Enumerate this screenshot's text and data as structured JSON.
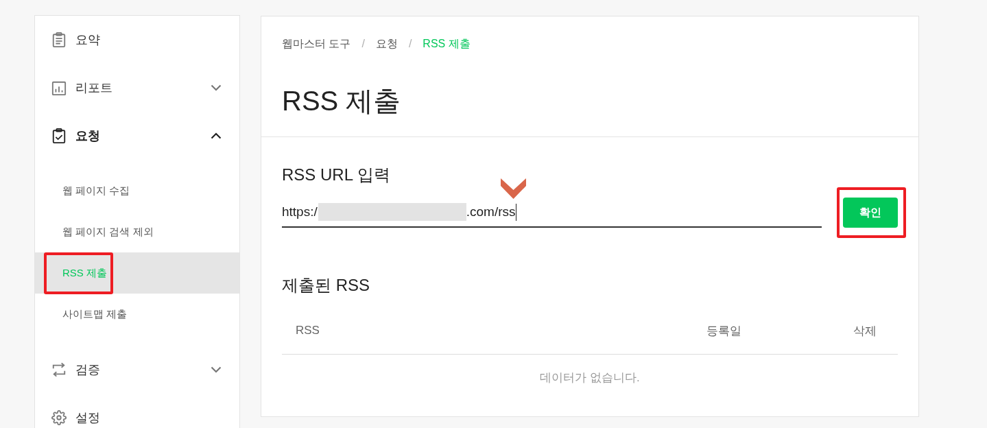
{
  "sidebar": {
    "items": [
      {
        "label": "요약",
        "kind": "link"
      },
      {
        "label": "리포트",
        "kind": "group",
        "expanded": false
      },
      {
        "label": "요청",
        "kind": "group",
        "expanded": true,
        "children": [
          {
            "label": "웹 페이지 수집",
            "selected": false,
            "highlighted": false
          },
          {
            "label": "웹 페이지 검색 제외",
            "selected": false,
            "highlighted": false
          },
          {
            "label": "RSS 제출",
            "selected": true,
            "highlighted": true
          },
          {
            "label": "사이트맵 제출",
            "selected": false,
            "highlighted": false
          }
        ]
      },
      {
        "label": "검증",
        "kind": "group",
        "expanded": false
      },
      {
        "label": "설정",
        "kind": "link"
      }
    ]
  },
  "breadcrumb": {
    "items": [
      {
        "label": "웹마스터 도구",
        "current": false
      },
      {
        "label": "요청",
        "current": false
      },
      {
        "label": "RSS 제출",
        "current": true
      }
    ],
    "separators": [
      "/",
      "/"
    ]
  },
  "page_title": "RSS 제출",
  "url_section": {
    "heading": "RSS URL 입력",
    "field": {
      "value_start": "https:/",
      "redacted": true,
      "value_end": ".com/rss",
      "focused": true,
      "marked": true
    },
    "submit_button": {
      "label": "확인",
      "highlighted": true
    }
  },
  "submitted_section": {
    "heading": "제출된 RSS",
    "table": {
      "columns": [
        "RSS",
        "등록일",
        "삭제"
      ],
      "empty_message": "데이터가 없습니다."
    }
  }
}
